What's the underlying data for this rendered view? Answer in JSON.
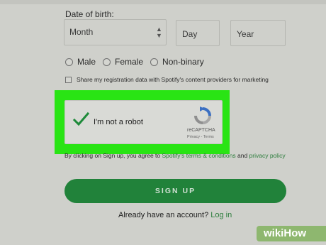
{
  "form": {
    "dob_label": "Date of birth:",
    "month_value": "Month",
    "day_placeholder": "Day",
    "year_placeholder": "Year",
    "gender_options": [
      "Male",
      "Female",
      "Non-binary"
    ],
    "share_label": "Share my registration data with Spotify's content providers for marketing"
  },
  "recaptcha": {
    "label": "I'm not a robot",
    "brand": "reCAPTCHA",
    "links": "Privacy - Terms",
    "checked": true,
    "highlight_color": "#29e414",
    "check_color": "#1e8a3a"
  },
  "terms": {
    "prefix": "By clicking on Sign up, you agree to ",
    "terms_link": "Spotify's terms & conditions",
    "middle": " and ",
    "privacy_link": "privacy policy"
  },
  "signup_button": "SIGN UP",
  "login": {
    "prompt": "Already have an account? ",
    "link": "Log in"
  },
  "watermark": {
    "wiki": "wiki",
    "how": "How"
  },
  "colors": {
    "accent_green": "#21823a",
    "link_green": "#2c7d3c"
  }
}
